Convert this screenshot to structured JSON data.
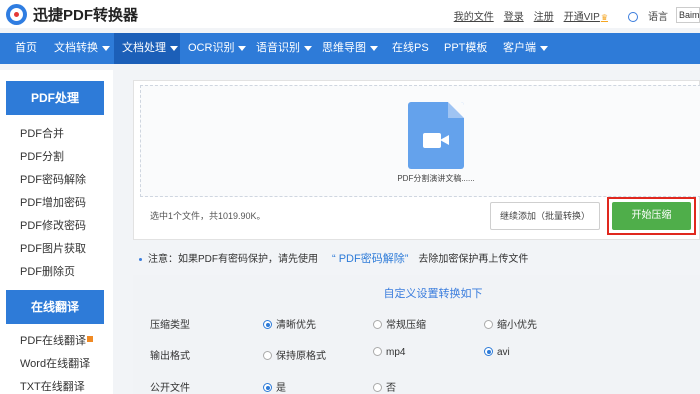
{
  "header": {
    "logo_text": "迅捷PDF转换器",
    "links": {
      "my_files": "我的文件",
      "login": "登录",
      "register": "注册",
      "vip": "开通VIP",
      "language": "语言",
      "search_value": "Baimi中"
    }
  },
  "nav": {
    "items": [
      {
        "label": "首页"
      },
      {
        "label": "文档转换"
      },
      {
        "label": "文档处理"
      },
      {
        "label": "OCR识别"
      },
      {
        "label": "语音识别"
      },
      {
        "label": "思维导图"
      },
      {
        "label": "在线PS"
      },
      {
        "label": "PPT模板"
      },
      {
        "label": "客户端"
      }
    ],
    "active_index": 2
  },
  "sidebar": {
    "section1_title": "PDF处理",
    "section1_items": [
      "PDF合并",
      "PDF分割",
      "PDF密码解除",
      "PDF增加密码",
      "PDF修改密码",
      "PDF图片获取",
      "PDF删除页"
    ],
    "section2_title": "在线翻译",
    "section2_items": [
      "PDF在线翻译",
      "Word在线翻译",
      "TXT在线翻译"
    ]
  },
  "upload": {
    "file_name": "PDF分割演讲文稿......",
    "status_text": "选中1个文件，共1019.90K。",
    "add_button_label": "继续添加（批量转换）",
    "start_button_label": "开始压缩"
  },
  "notice": {
    "prefix": "注意：如果PDF有密码保护，请先使用",
    "link_text": "“ PDF密码解除”",
    "suffix": "去除加密保护再上传文件"
  },
  "settings": {
    "title": "自定义设置转换如下",
    "compression_label": "压缩类型",
    "compression_options": [
      "清晰优先",
      "常规压缩",
      "缩小优先"
    ],
    "output_label": "输出格式",
    "output_options": [
      "保持原格式",
      "mp4",
      "avi"
    ],
    "public_label": "公开文件",
    "public_options": [
      "是",
      "否"
    ]
  },
  "colors": {
    "brand_blue": "#2e7bd8",
    "start_green": "#4fae4a",
    "highlight_red": "#e0281e"
  }
}
